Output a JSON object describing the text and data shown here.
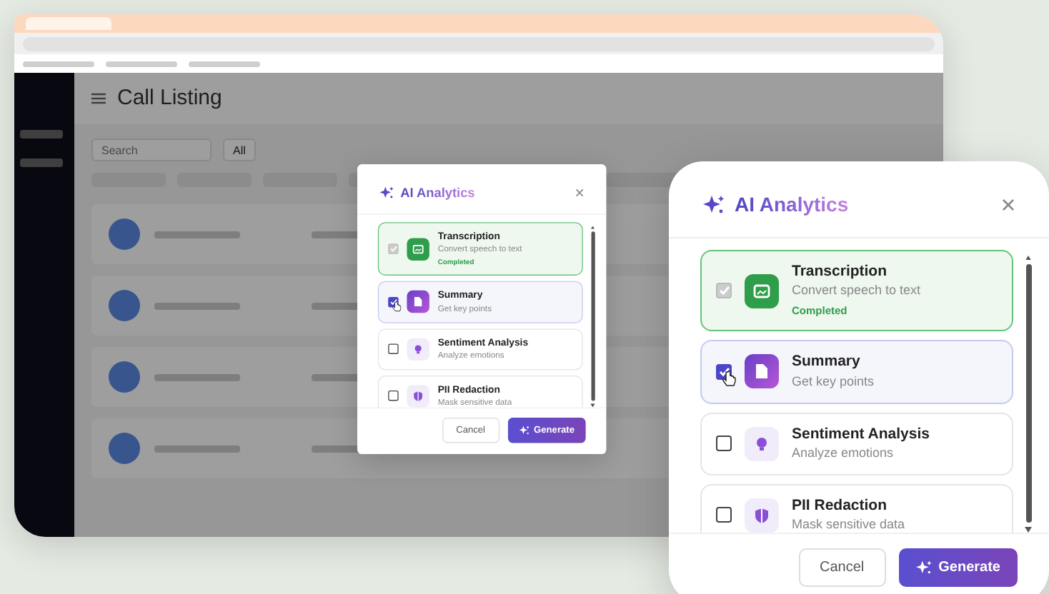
{
  "app": {
    "page_title": "Call Listing",
    "search": {
      "placeholder": "Search"
    },
    "search_scope": "All"
  },
  "dialogs": [
    {
      "title": "AI Analytics",
      "options": [
        {
          "title": "Transcription",
          "description": "Convert speech to text",
          "status": "Completed",
          "checked": true,
          "disabled": true
        },
        {
          "title": "Summary",
          "description": "Get key points",
          "checked": true,
          "disabled": false
        },
        {
          "title": "Sentiment Analysis",
          "description": "Analyze emotions",
          "checked": false,
          "disabled": false
        },
        {
          "title": "PII Redaction",
          "description": "Mask sensitive data",
          "checked": false,
          "disabled": false
        }
      ],
      "cancel_label": "Cancel",
      "generate_label": "Generate"
    },
    {
      "title": "AI Analytics",
      "options": [
        {
          "title": "Transcription",
          "description": "Convert speech to text",
          "status": "Completed",
          "checked": true,
          "disabled": true
        },
        {
          "title": "Summary",
          "description": "Get key points",
          "checked": true,
          "disabled": false
        },
        {
          "title": "Sentiment Analysis",
          "description": "Analyze emotions",
          "checked": false,
          "disabled": false
        },
        {
          "title": "PII Redaction",
          "description": "Mask sensitive data",
          "checked": false,
          "disabled": false
        }
      ],
      "cancel_label": "Cancel",
      "generate_label": "Generate"
    }
  ]
}
